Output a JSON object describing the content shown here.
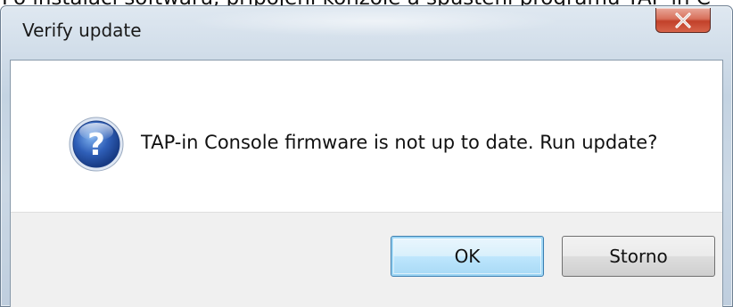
{
  "background_caption": "Po instalaci softwaru, připojení konzole a spuštění programu TAP-in C",
  "dialog": {
    "title": "Verify update",
    "close_icon": "close-x-icon",
    "message_icon": "question-icon",
    "message": "TAP-in Console firmware is not up to date. Run update?",
    "buttons": {
      "ok_label": "OK",
      "storno_label": "Storno",
      "default": "OK"
    }
  },
  "colors": {
    "close_button": "#c7462d",
    "icon_blue": "#2f5fb8",
    "default_button_border": "#3c7fb1"
  }
}
